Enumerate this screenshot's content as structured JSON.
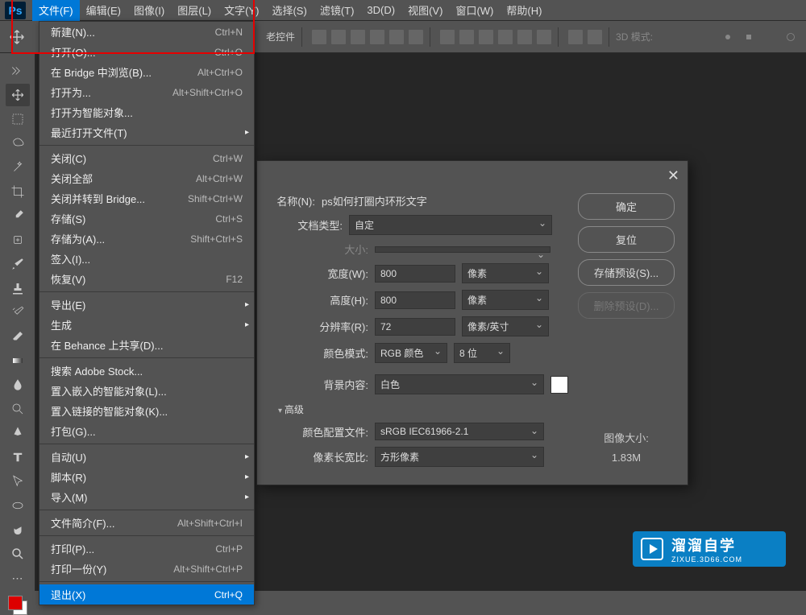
{
  "logo": "Ps",
  "menubar": {
    "items": [
      "文件(F)",
      "编辑(E)",
      "图像(I)",
      "图层(L)",
      "文字(Y)",
      "选择(S)",
      "滤镜(T)",
      "3D(D)",
      "视图(V)",
      "窗口(W)",
      "帮助(H)"
    ]
  },
  "options_bar": {
    "label": "老控件",
    "mode_label": "3D 模式:"
  },
  "file_menu": {
    "items": [
      {
        "label": "新建(N)...",
        "shortcut": "Ctrl+N"
      },
      {
        "label": "打开(O)...",
        "shortcut": "Ctrl+O"
      },
      {
        "label": "在 Bridge 中浏览(B)...",
        "shortcut": "Alt+Ctrl+O"
      },
      {
        "label": "打开为...",
        "shortcut": "Alt+Shift+Ctrl+O"
      },
      {
        "label": "打开为智能对象..."
      },
      {
        "label": "最近打开文件(T)",
        "submenu": true
      },
      {
        "sep": true
      },
      {
        "label": "关闭(C)",
        "shortcut": "Ctrl+W"
      },
      {
        "label": "关闭全部",
        "shortcut": "Alt+Ctrl+W"
      },
      {
        "label": "关闭并转到 Bridge...",
        "shortcut": "Shift+Ctrl+W"
      },
      {
        "label": "存储(S)",
        "shortcut": "Ctrl+S"
      },
      {
        "label": "存储为(A)...",
        "shortcut": "Shift+Ctrl+S"
      },
      {
        "label": "签入(I)..."
      },
      {
        "label": "恢复(V)",
        "shortcut": "F12"
      },
      {
        "sep": true
      },
      {
        "label": "导出(E)",
        "submenu": true
      },
      {
        "label": "生成",
        "submenu": true
      },
      {
        "label": "在 Behance 上共享(D)..."
      },
      {
        "sep": true
      },
      {
        "label": "搜索 Adobe Stock..."
      },
      {
        "label": "置入嵌入的智能对象(L)..."
      },
      {
        "label": "置入链接的智能对象(K)..."
      },
      {
        "label": "打包(G)..."
      },
      {
        "sep": true
      },
      {
        "label": "自动(U)",
        "submenu": true
      },
      {
        "label": "脚本(R)",
        "submenu": true
      },
      {
        "label": "导入(M)",
        "submenu": true
      },
      {
        "sep": true
      },
      {
        "label": "文件简介(F)...",
        "shortcut": "Alt+Shift+Ctrl+I"
      },
      {
        "sep": true
      },
      {
        "label": "打印(P)...",
        "shortcut": "Ctrl+P"
      },
      {
        "label": "打印一份(Y)",
        "shortcut": "Alt+Shift+Ctrl+P"
      },
      {
        "sep": true
      },
      {
        "label": "退出(X)",
        "shortcut": "Ctrl+Q",
        "highlighted": true
      }
    ]
  },
  "dialog": {
    "name_label": "名称(N):",
    "name_value": "ps如何打圈内环形文字",
    "doc_type_label": "文档类型:",
    "doc_type_value": "自定",
    "size_label": "大小:",
    "width_label": "宽度(W):",
    "width_value": "800",
    "width_unit": "像素",
    "height_label": "高度(H):",
    "height_value": "800",
    "height_unit": "像素",
    "res_label": "分辨率(R):",
    "res_value": "72",
    "res_unit": "像素/英寸",
    "color_mode_label": "颜色模式:",
    "color_mode_value": "RGB 颜色",
    "color_depth": "8 位",
    "bg_label": "背景内容:",
    "bg_value": "白色",
    "advanced_label": "高级",
    "profile_label": "颜色配置文件:",
    "profile_value": "sRGB IEC61966-2.1",
    "aspect_label": "像素长宽比:",
    "aspect_value": "方形像素",
    "ok": "确定",
    "reset": "复位",
    "save_preset": "存储预设(S)...",
    "delete_preset": "删除预设(D)...",
    "image_size_label": "图像大小:",
    "image_size_value": "1.83M"
  },
  "watermark": {
    "main": "溜溜自学",
    "sub": "ZIXUE.3D66.COM"
  }
}
